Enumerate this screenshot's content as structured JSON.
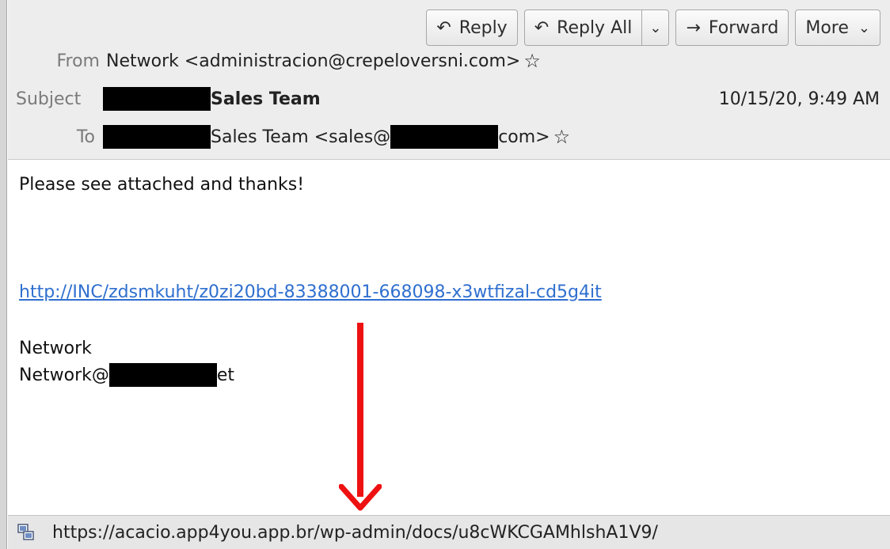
{
  "toolbar": {
    "reply": {
      "label": "Reply",
      "glyph": "↶"
    },
    "reply_all": {
      "label": "Reply All",
      "glyph": "↶"
    },
    "reply_all_dropdown": "⌄",
    "forward": {
      "label": "Forward",
      "glyph": "→"
    },
    "more": {
      "label": "More",
      "dropdown": "⌄"
    }
  },
  "headers": {
    "from_label": "From",
    "from_value": "Network <administracion@crepeloversni.com>",
    "subject_label": "Subject",
    "subject_value": "Sales Team",
    "to_label": "To",
    "to_value_part1": "Sales Team <sales@",
    "to_value_part2": "com>",
    "date": "10/15/20, 9:49 AM",
    "star_glyph": "☆"
  },
  "body": {
    "line1": "Please see attached and thanks!",
    "link": "http://INC/zdsmkuht/z0zi20bd-83388001-668098-x3wtfizal-cd5g4it",
    "signature_name": "Network",
    "signature_email_prefix": "Network@",
    "signature_email_suffix": "et"
  },
  "statusbar": {
    "url": "https://acacio.app4you.app.br/wp-admin/docs/u8cWKCGAMhlshA1V9/"
  },
  "colors": {
    "link": "#2f6fcf",
    "arrow": "#ee1111",
    "redaction": "#000000"
  }
}
